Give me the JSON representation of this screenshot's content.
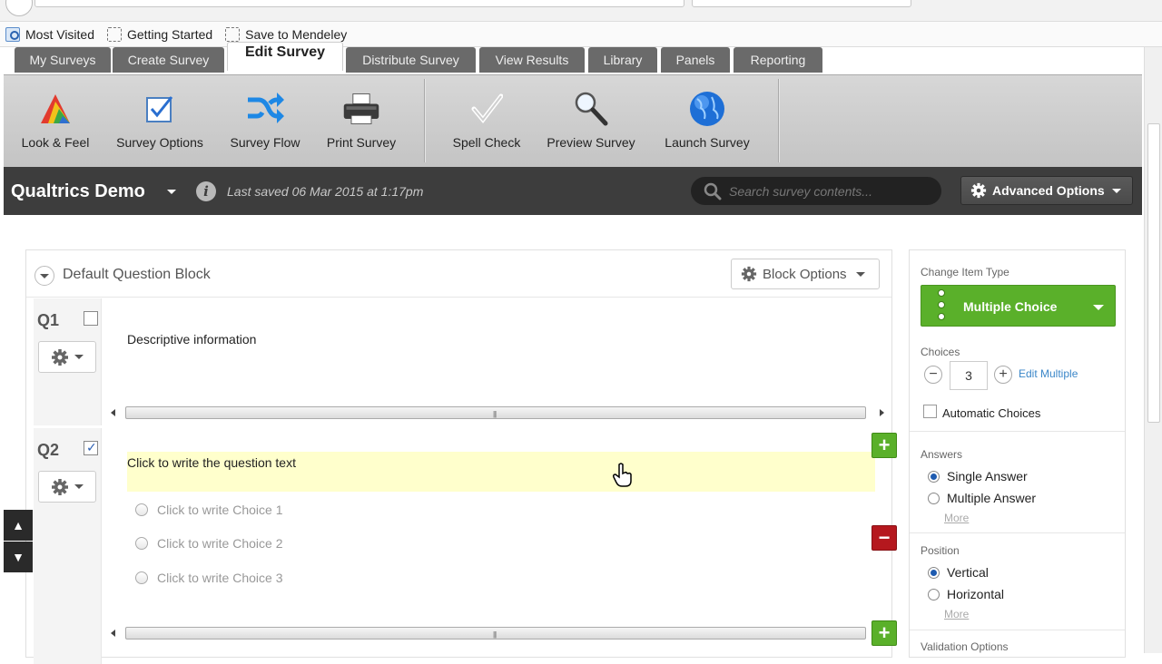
{
  "bookmarks": [
    {
      "label": "Most Visited"
    },
    {
      "label": "Getting Started"
    },
    {
      "label": "Save to Mendeley"
    }
  ],
  "tabs": [
    {
      "label": "My Surveys"
    },
    {
      "label": "Create Survey"
    },
    {
      "label": "Edit Survey",
      "active": true
    },
    {
      "label": "Distribute Survey"
    },
    {
      "label": "View Results"
    },
    {
      "label": "Library"
    },
    {
      "label": "Panels"
    },
    {
      "label": "Reporting"
    }
  ],
  "toolbar": {
    "look_feel": "Look & Feel",
    "survey_options": "Survey Options",
    "survey_flow": "Survey Flow",
    "print_survey": "Print Survey",
    "spell_check": "Spell Check",
    "preview_survey": "Preview Survey",
    "launch_survey": "Launch Survey"
  },
  "header": {
    "survey_name": "Qualtrics Demo",
    "last_saved": "Last saved 06 Mar 2015 at 1:17pm",
    "search_placeholder": "Search survey contents...",
    "advanced_options": "Advanced Options"
  },
  "block": {
    "title": "Default Question Block",
    "options_label": "Block Options"
  },
  "questions": [
    {
      "number": "Q1",
      "text": "Descriptive information",
      "checked": false
    },
    {
      "number": "Q2",
      "text": "Click to write the question text",
      "checked": true,
      "choices": [
        "Click to write Choice 1",
        "Click to write Choice 2",
        "Click to write Choice 3"
      ]
    }
  ],
  "panel": {
    "change_item_type": "Change Item Type",
    "item_type": "Multiple Choice",
    "choices_label": "Choices",
    "choices_count": "3",
    "edit_multiple": "Edit Multiple",
    "automatic_choices": "Automatic Choices",
    "answers_label": "Answers",
    "answers": [
      "Single Answer",
      "Multiple Answer"
    ],
    "more": "More",
    "position_label": "Position",
    "positions": [
      "Vertical",
      "Horizontal"
    ],
    "validation_label": "Validation Options"
  },
  "colors": {
    "green": "#5ab02a",
    "red": "#b5181e",
    "darkbar": "#3d3d3d",
    "tab": "#6a6a6a",
    "highlight": "#ffffcc"
  }
}
